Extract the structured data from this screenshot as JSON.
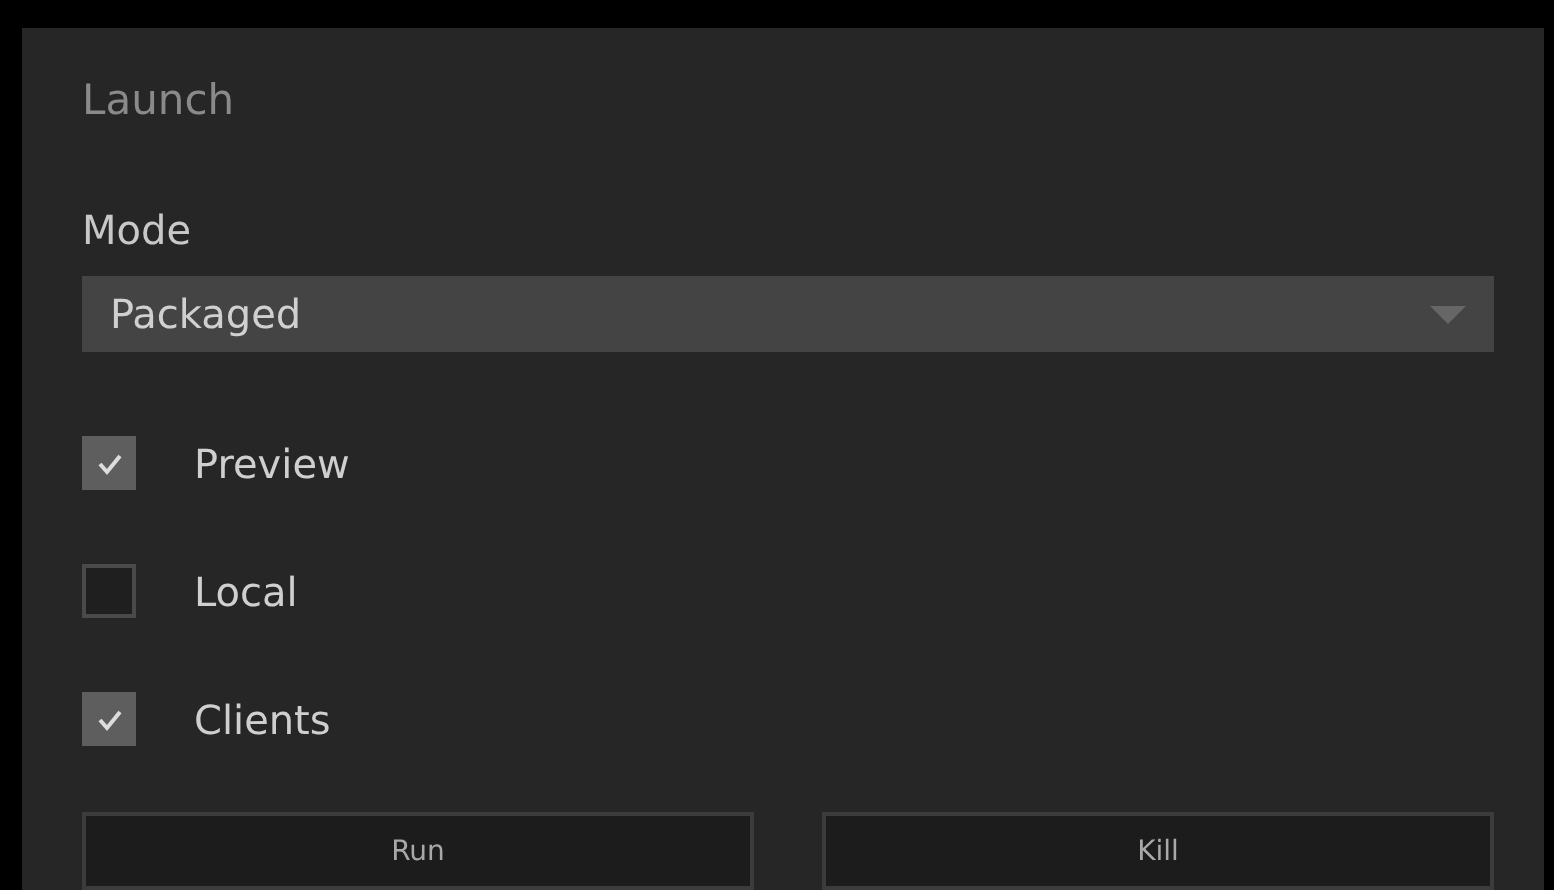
{
  "panel": {
    "title": "Launch"
  },
  "mode": {
    "label": "Mode",
    "value": "Packaged"
  },
  "options": [
    {
      "label": "Preview",
      "checked": true
    },
    {
      "label": "Local",
      "checked": false
    },
    {
      "label": "Clients",
      "checked": true
    }
  ],
  "buttons": [
    "Run",
    "Kill"
  ]
}
